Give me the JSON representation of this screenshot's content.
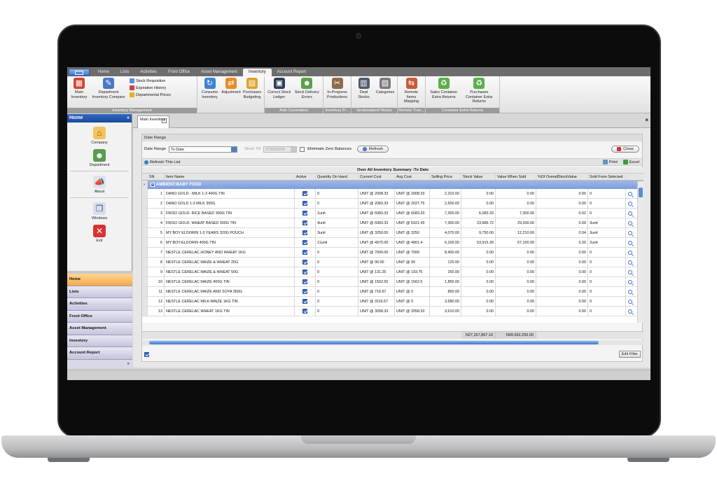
{
  "ribbon_tabs": [
    "Home",
    "Lists",
    "Activities",
    "Front Office",
    "Asset Management",
    "Inventory",
    "Account Report"
  ],
  "active_tab": "Inventory",
  "ribbon": {
    "main_inventory": "Main Inventory",
    "department_inventory_compare": "Department Inventory Compare",
    "stock_requisition": "Stock Requisition",
    "expiration_history": "Expiration History",
    "departmental_prices": "Departmental Prices",
    "consume_inventory": "Consume Inventory",
    "adjustment": "Adjustment",
    "purchases_budgeting": "Purchases Budgeting",
    "group_inventory_management": "Inventory Management",
    "correct_stock_ledger": "Correct Stock Ledger",
    "stock_delivery_errors": "Stock Delivery Errors",
    "group_auto_corrections": "Auto Corrections",
    "in_progress_productions": "In-Progress Productions",
    "group_inventory_pr": "Inventory Pr...",
    "dept_stocks": "Dept Stocks",
    "categories": "Categories",
    "group_sectionalized_stocks": "Sectionalized Stocks",
    "remote_items_mapping": "Remote Items Mapping",
    "group_remote_tran": "Remote Tran...",
    "sales_container_extra_returns": "Sales Container Extra Returns",
    "purchases_container_extra_returns": "Purchases Container Extra Returns",
    "group_container_extra_returns": "Container Extra Returns"
  },
  "sidebar": {
    "title": "Home",
    "items": [
      "Company",
      "Department",
      "About",
      "Windows",
      "Exit"
    ],
    "nav": [
      "Home",
      "Lists",
      "Activities",
      "Front Office",
      "Asset Management",
      "Inventory",
      "Account Report"
    ]
  },
  "doc_tab": "Main Inventory",
  "filters": {
    "section_title": "Date Range",
    "date_range_label": "Date Range",
    "date_range_value": "To Date",
    "stock_till_label": "Stock Till",
    "stock_till_value": "27/06/2024",
    "eliminate_zero": "Eliminate Zero Balances",
    "refresh": "Refresh",
    "close": "Close"
  },
  "list_toolbar": {
    "refresh_list": "Refresh This List",
    "print": "Print",
    "excel": "Excel"
  },
  "grid": {
    "title": "Over All Inventory Summary :To Date",
    "columns": [
      "SN",
      "Item Name",
      "Active",
      "Quantity On Hand",
      "Current Cost",
      "Avg Cost",
      "Selling Price",
      "Stock Value",
      "Value When Sold",
      "%Of OverallStockValue",
      "Sold From Selected"
    ],
    "group": "AMBIENT:BABY FOOD",
    "rows": [
      {
        "sn": "1",
        "name": "DANO GOLD - MILK 1-3 400G TIN",
        "qty": "0",
        "cc": "UNIT @ 2008.33",
        "ac": "UNIT @ 2008.33",
        "sp": "2,310.00",
        "sv": "0.00",
        "vws": "0.00",
        "pct": "0.00",
        "sold": "0"
      },
      {
        "sn": "2",
        "name": "DANO GOLD 1-3 MILK 350G",
        "qty": "0",
        "cc": "UNIT @ 2083.33",
        "ac": "UNIT @ 2027.75",
        "sp": "2,500.00",
        "sv": "0.00",
        "vws": "0.00",
        "pct": "0.00",
        "sold": "0"
      },
      {
        "sn": "3",
        "name": "FRISO GOLD- RICE BASED 300G TIN",
        "qty": "1unit",
        "cc": "UNIT @ 6083.33",
        "ac": "UNIT @ 6083.33",
        "sp": "7,300.00",
        "sv": "6,083.33",
        "vws": "7,300.00",
        "pct": "0.02",
        "sold": "0"
      },
      {
        "sn": "4",
        "name": "FRISO GOLD- WHEAT BASED 300G TIN",
        "qty": "4unit",
        "cc": "UNIT @ 6083.33",
        "ac": "UNIT @ 5921.43",
        "sp": "7,300.00",
        "sv": "23,685.72",
        "vws": "29,200.00",
        "pct": "0.09",
        "sold": "3unit"
      },
      {
        "sn": "5",
        "name": "MY BOY ELDORIN 1-3 YEARS 320G POUCH",
        "qty": "3unit",
        "cc": "UNIT @ 3250.00",
        "ac": "UNIT @ 3250",
        "sp": "4,070.00",
        "sv": "9,750.00",
        "vws": "12,210.00",
        "pct": "0.04",
        "sold": "3unit"
      },
      {
        "sn": "6",
        "name": "MY BOY-ELDORIN 400G TIN",
        "qty": "11unit",
        "cc": "UNIT @ 4975.00",
        "ac": "UNIT @ 4901.4",
        "sp": "6,100.00",
        "sv": "53,915.39",
        "vws": "67,100.00",
        "pct": "0.20",
        "sold": "2unit"
      },
      {
        "sn": "7",
        "name": "NESTLE CERELAC HONEY AND WHEAT 1KG",
        "qty": "0",
        "cc": "UNIT @ 7000.00",
        "ac": "UNIT @ 7000",
        "sp": "8,400.00",
        "sv": "0.00",
        "vws": "0.00",
        "pct": "0.00",
        "sold": "0"
      },
      {
        "sn": "8",
        "name": "NESTLE CERELAC MAIZE & WHEAT 25G",
        "qty": "0",
        "cc": "UNIT @ 90.00",
        "ac": "UNIT @ 90",
        "sp": "120.00",
        "sv": "0.00",
        "vws": "0.00",
        "pct": "0.00",
        "sold": "0"
      },
      {
        "sn": "9",
        "name": "NESTLE CERELAC MAIZE & WHEAT 50G",
        "qty": "0",
        "cc": "UNIT @ 131.25",
        "ac": "UNIT @ 193.75",
        "sp": "250.00",
        "sv": "0.00",
        "vws": "0.00",
        "pct": "0.00",
        "sold": "0"
      },
      {
        "sn": "10",
        "name": "NESTLE CERELAC MAIZE 400G TIN",
        "qty": "0",
        "cc": "UNIT @ 1562.50",
        "ac": "UNIT @ 1562.5",
        "sp": "1,850.00",
        "sv": "0.00",
        "vws": "0.00",
        "pct": "0.00",
        "sold": "0"
      },
      {
        "sn": "11",
        "name": "NESTLE CERELAC MAIZE AND SOYA 350G",
        "qty": "0",
        "cc": "UNIT @ 716.67",
        "ac": "UNIT @ 0",
        "sp": "850.00",
        "sv": "0.00",
        "vws": "0.00",
        "pct": "0.00",
        "sold": "0"
      },
      {
        "sn": "12",
        "name": "NESTLE CERELAC MILK-MAIZE 1KG TIN",
        "qty": "0",
        "cc": "UNIT @ 3116.67",
        "ac": "UNIT @ 0",
        "sp": "3,680.00",
        "sv": "0.00",
        "vws": "0.00",
        "pct": "0.00",
        "sold": "0"
      },
      {
        "sn": "13",
        "name": "NESTLE CERELAC WHEAT 1KG TIN",
        "qty": "0",
        "cc": "UNIT @ 3058.33",
        "ac": "UNIT @ 3058.33",
        "sp": "3,610.00",
        "sv": "0.00",
        "vws": "0.00",
        "pct": "0.00",
        "sold": "0"
      }
    ],
    "total_stock_value": "N27,157,867.10",
    "total_value_when_sold": "N99,692,255.00"
  },
  "edit_filter": "Edit Filter",
  "colors": {
    "accent": "#2f67c4",
    "group_row": "#8aa6de",
    "active_nav": "#f5a848"
  }
}
